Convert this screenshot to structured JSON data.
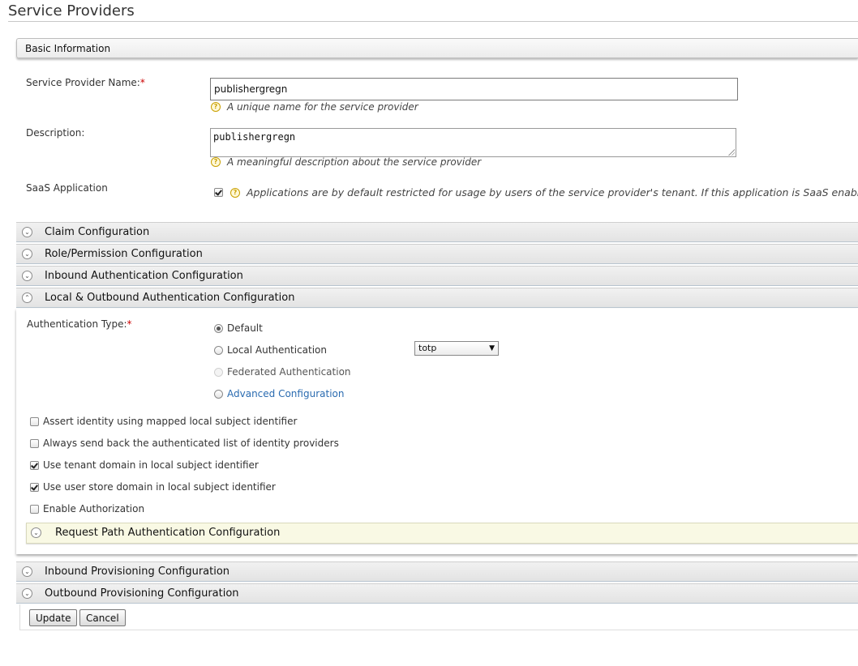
{
  "page": {
    "title": "Service Providers"
  },
  "basic_info": {
    "header": "Basic Information",
    "name_label": "Service Provider Name:",
    "required_mark": "*",
    "name_value": "publishergregn",
    "name_help": "A unique name for the service provider",
    "description_label": "Description:",
    "description_value": "publishergregn",
    "description_help": "A meaningful description about the service provider",
    "saas_label": "SaaS Application",
    "saas_checked": true,
    "saas_help": "Applications are by default restricted for usage by users of the service provider's tenant. If this application is SaaS enabled it"
  },
  "sections": {
    "claim": "Claim Configuration",
    "role": "Role/Permission Configuration",
    "inbound_auth": "Inbound Authentication Configuration",
    "local_outbound": "Local & Outbound Authentication Configuration",
    "inbound_prov": "Inbound Provisioning Configuration",
    "outbound_prov": "Outbound Provisioning Configuration"
  },
  "auth": {
    "type_label": "Authentication Type:",
    "required_mark": "*",
    "options": {
      "default": "Default",
      "local": "Local Authentication",
      "federated": "Federated Authentication",
      "advanced": "Advanced Configuration"
    },
    "selected": "default",
    "local_select_value": "totp",
    "select_arrow": "▼",
    "checks": {
      "assert_identity": "Assert identity using mapped local subject identifier",
      "always_send": "Always send back the authenticated list of identity providers",
      "use_tenant": "Use tenant domain in local subject identifier",
      "use_userstore": "Use user store domain in local subject identifier",
      "enable_authz": "Enable Authorization"
    },
    "request_path": "Request Path Authentication Configuration"
  },
  "icons": {
    "chevron_down": "⌄",
    "chevron_up": "⌃",
    "help": "?"
  },
  "buttons": {
    "update": "Update",
    "cancel": "Cancel"
  }
}
